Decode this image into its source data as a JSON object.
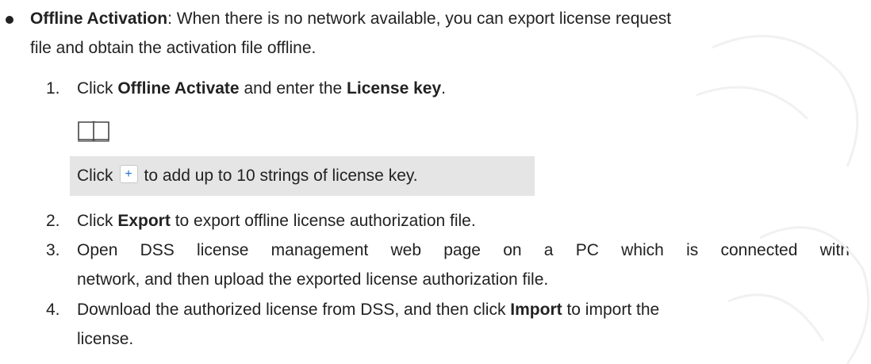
{
  "bullet": {
    "title": "Offline Activation",
    "text_after_title": ": When there is no network available, you can export license request",
    "text_line2": "file and obtain the activation file offline."
  },
  "steps": [
    {
      "num": "1.",
      "pre": "Click ",
      "b1": "Offline Activate",
      "mid": " and enter the ",
      "b2": "License key",
      "post": "."
    },
    {
      "num": "2.",
      "pre": "Click ",
      "b1": "Export",
      "post": " to export offline license authorization file."
    },
    {
      "num": "3.",
      "line1": "Open DSS license management web page on a PC which is connected with",
      "line2": "network, and then upload the exported license authorization file."
    },
    {
      "num": "4.",
      "line1_pre": "Download the authorized license from DSS, and then click ",
      "line1_b": "Import",
      "line1_post": " to import the",
      "line2": "license."
    }
  ],
  "note": {
    "icon": "book-icon",
    "pre": "Click",
    "button_icon": "+",
    "post": "to add up to 10 strings of license key."
  },
  "colors": {
    "text": "#222222",
    "note_bg": "#e5e5e5",
    "plus": "#1f6fd0"
  }
}
